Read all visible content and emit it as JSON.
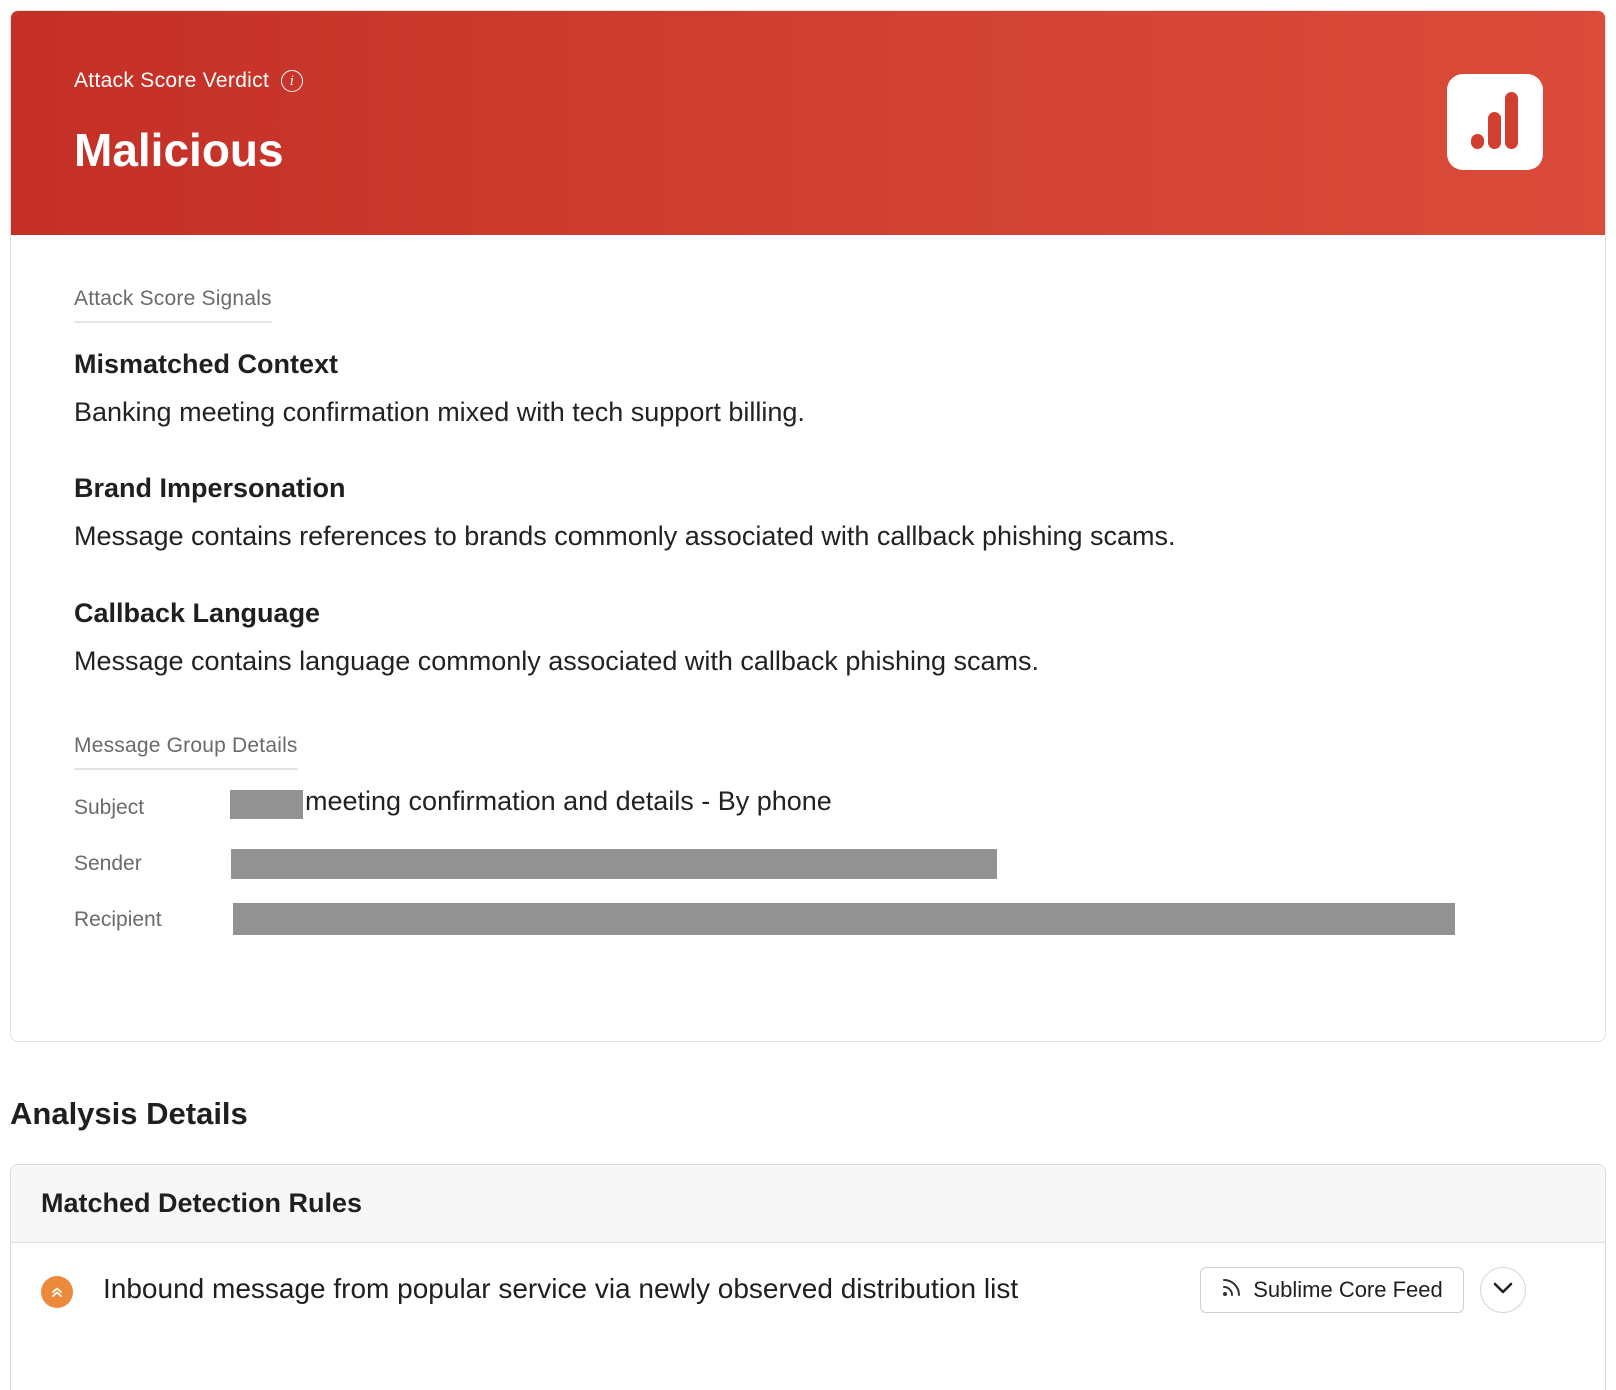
{
  "verdict": {
    "label": "Attack Score Verdict",
    "value": "Malicious",
    "info_icon": "info-icon",
    "score_icon": "bar-chart-icon",
    "color": "#c92f26"
  },
  "signals": {
    "section_label": "Attack Score Signals",
    "items": [
      {
        "title": "Mismatched Context",
        "description": "Banking meeting confirmation mixed with tech support billing."
      },
      {
        "title": "Brand Impersonation",
        "description": "Message contains references to brands commonly associated with callback phishing scams."
      },
      {
        "title": "Callback Language",
        "description": "Message contains language commonly associated with callback phishing scams."
      }
    ]
  },
  "message_group": {
    "section_label": "Message Group Details",
    "subject_label": "Subject",
    "subject_value": "meeting confirmation and details - By phone",
    "sender_label": "Sender",
    "recipient_label": "Recipient"
  },
  "analysis": {
    "title": "Analysis Details",
    "rules_header": "Matched Detection Rules",
    "rules": [
      {
        "name": "Inbound message from popular service via newly observed distribution list",
        "severity_color": "#ea8a3a",
        "feed_label": "Sublime Core Feed",
        "feed_icon": "rss-icon",
        "expand_icon": "chevron-down-icon"
      }
    ]
  }
}
